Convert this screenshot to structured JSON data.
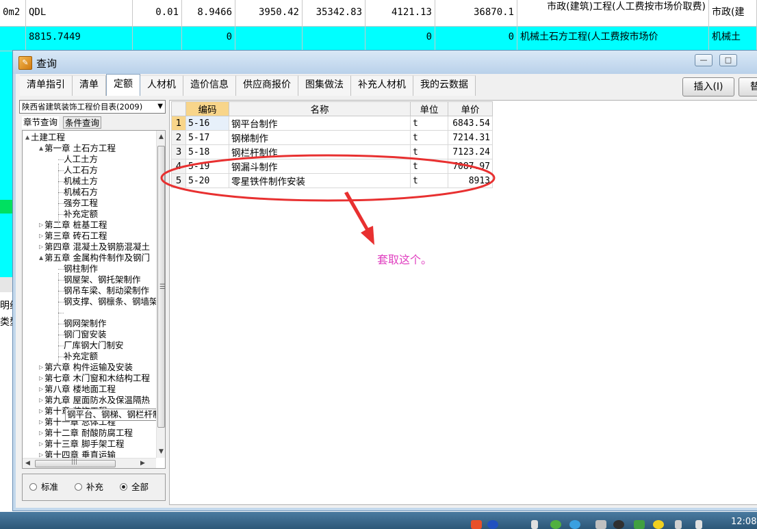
{
  "background_sheet": {
    "row1": {
      "unit": "0m2",
      "code": "QDL",
      "v1": "0.01",
      "v2": "8.9466",
      "v3": "3950.42",
      "v4": "35342.83",
      "v5": "4121.13",
      "v6": "36870.1",
      "desc": "市政(建筑)工程(人工费按市场价取费)",
      "desc2": "市政(建"
    },
    "row2": {
      "code": "8815.7449",
      "v2": "0",
      "v5": "0",
      "v6": "0",
      "desc": "机械土石方工程(人工费按市场价",
      "desc2": "机械土"
    },
    "side_text_1": "明组",
    "side_text_2": "类型"
  },
  "dialog": {
    "title": "查询",
    "title_icon": "app-icon",
    "window_buttons": {
      "minimize": "—",
      "maximize": "□"
    },
    "tabs": [
      "清单指引",
      "清单",
      "定额",
      "人材机",
      "造价信息",
      "供应商报价",
      "图集做法",
      "补充人材机",
      "我的云数据"
    ],
    "active_tab": "定额",
    "insert_button": "插入(I)",
    "replace_button": "替"
  },
  "left_panel": {
    "library": "陕西省建筑装饰工程价目表(2009)",
    "subtabs": {
      "chapter": "章节查询",
      "condition": "条件查询"
    },
    "tree": [
      {
        "label": "土建工程",
        "level": 0,
        "expander": "▲"
      },
      {
        "label": "第一章 土石方工程",
        "level": 1,
        "expander": "▲"
      },
      {
        "label": "人工土方",
        "level": 2
      },
      {
        "label": "人工石方",
        "level": 2
      },
      {
        "label": "机械土方",
        "level": 2
      },
      {
        "label": "机械石方",
        "level": 2
      },
      {
        "label": "强夯工程",
        "level": 2
      },
      {
        "label": "补充定额",
        "level": 2
      },
      {
        "label": "第二章 桩基工程",
        "level": 1,
        "expander": "▷"
      },
      {
        "label": "第三章 砖石工程",
        "level": 1,
        "expander": "▷"
      },
      {
        "label": "第四章 混凝土及钢筋混凝土",
        "level": 1,
        "expander": "▷"
      },
      {
        "label": "第五章 金属构件制作及钢门",
        "level": 1,
        "expander": "▲"
      },
      {
        "label": "钢柱制作",
        "level": 2
      },
      {
        "label": "钢屋架、钢托架制作",
        "level": 2
      },
      {
        "label": "钢吊车梁、制动梁制作",
        "level": 2
      },
      {
        "label": "钢支撑、钢檩条、钢墙架",
        "level": 2
      },
      {
        "label": "钢平台、钢梯、钢栏杆制作",
        "level": 2,
        "selected": true
      },
      {
        "label": "钢网架制作",
        "level": 2
      },
      {
        "label": "钢门窗安装",
        "level": 2
      },
      {
        "label": "厂库钢大门制安",
        "level": 2
      },
      {
        "label": "补充定额",
        "level": 2
      },
      {
        "label": "第六章 构件运输及安装",
        "level": 1,
        "expander": "▷"
      },
      {
        "label": "第七章 木门窗和木结构工程",
        "level": 1,
        "expander": "▷"
      },
      {
        "label": "第八章 楼地面工程",
        "level": 1,
        "expander": "▷"
      },
      {
        "label": "第九章 屋面防水及保温隔热",
        "level": 1,
        "expander": "▷"
      },
      {
        "label": "第十章 装饰工程",
        "level": 1,
        "expander": "▷"
      },
      {
        "label": "第十一章 总体工程",
        "level": 1,
        "expander": "▷"
      },
      {
        "label": "第十二章 耐酸防腐工程",
        "level": 1,
        "expander": "▷"
      },
      {
        "label": "第十三章 脚手架工程",
        "level": 1,
        "expander": "▷"
      },
      {
        "label": "第十四章 垂直运输",
        "level": 1,
        "expander": "▷"
      }
    ],
    "scroll": {
      "up": "▲",
      "down": "▼",
      "left": "◀",
      "right": "▶",
      "grip_v": "☰",
      "grip_h": "|||"
    },
    "radios": [
      {
        "label": "标准",
        "checked": false
      },
      {
        "label": "补充",
        "checked": false
      },
      {
        "label": "全部",
        "checked": true
      }
    ]
  },
  "results": {
    "columns": [
      "编码",
      "名称",
      "单位",
      "单价"
    ],
    "rows": [
      {
        "n": "1",
        "code": "5-16",
        "name": "钢平台制作",
        "unit": "t",
        "price": "6843.54"
      },
      {
        "n": "2",
        "code": "5-17",
        "name": "钢梯制作",
        "unit": "t",
        "price": "7214.31"
      },
      {
        "n": "3",
        "code": "5-18",
        "name": "钢栏杆制作",
        "unit": "t",
        "price": "7123.24"
      },
      {
        "n": "4",
        "code": "5-19",
        "name": "钢漏斗制作",
        "unit": "t",
        "price": "7087.97"
      },
      {
        "n": "5",
        "code": "5-20",
        "name": "零星铁件制作安装",
        "unit": "t",
        "price": "8913"
      }
    ],
    "selected_row": 1
  },
  "annotation": {
    "text": "套取这个。",
    "color": "#e040c0",
    "ellipse_color": "#e83030"
  },
  "taskbar": {
    "clock": "12:08"
  }
}
